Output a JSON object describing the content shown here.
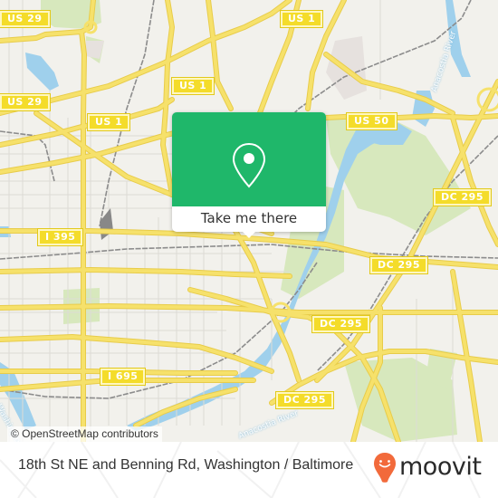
{
  "map": {
    "region": "Washington, DC (NE / Anacostia)",
    "colors": {
      "background": "#f2f1ec",
      "road": "#f6e16b",
      "road_casing": "#e8cc4a",
      "minor_road": "#d9d8d2",
      "water": "#9fd0ec",
      "park": "#d3e6b5",
      "rail": "#8a8a8a",
      "shield_bg": "#f4dc2a",
      "shield_text": "#ffffff"
    },
    "road_shields": [
      {
        "label": "US 29",
        "id": "us-29-north"
      },
      {
        "label": "US 29",
        "id": "us-29-south"
      },
      {
        "label": "US 1",
        "id": "us-1-top"
      },
      {
        "label": "US 1",
        "id": "us-1-middle"
      },
      {
        "label": "US 1",
        "id": "us-1-west"
      },
      {
        "label": "US 50",
        "id": "us-50"
      },
      {
        "label": "I 395",
        "id": "i-395"
      },
      {
        "label": "DC 295",
        "id": "dc-295-east"
      },
      {
        "label": "DC 295",
        "id": "dc-295-north"
      },
      {
        "label": "DC 295",
        "id": "dc-295-middle"
      },
      {
        "label": "DC 295",
        "id": "dc-295-south"
      },
      {
        "label": "I 695",
        "id": "i-695"
      }
    ],
    "water_labels": [
      {
        "label": "Anacostia River",
        "id": "anacostia-river-north"
      },
      {
        "label": "Anacostia River",
        "id": "anacostia-river-south"
      },
      {
        "label": "Washington Channel",
        "id": "washington-channel"
      }
    ],
    "attribution": "© OpenStreetMap contributors"
  },
  "popup": {
    "icon": "map-pin-icon",
    "action_label": "Take me there",
    "accent_color": "#1fb76a"
  },
  "footer": {
    "title": "18th St NE and Benning Rd, Washington / Baltimore",
    "brand": "moovit",
    "brand_color": "#f26a3b"
  }
}
